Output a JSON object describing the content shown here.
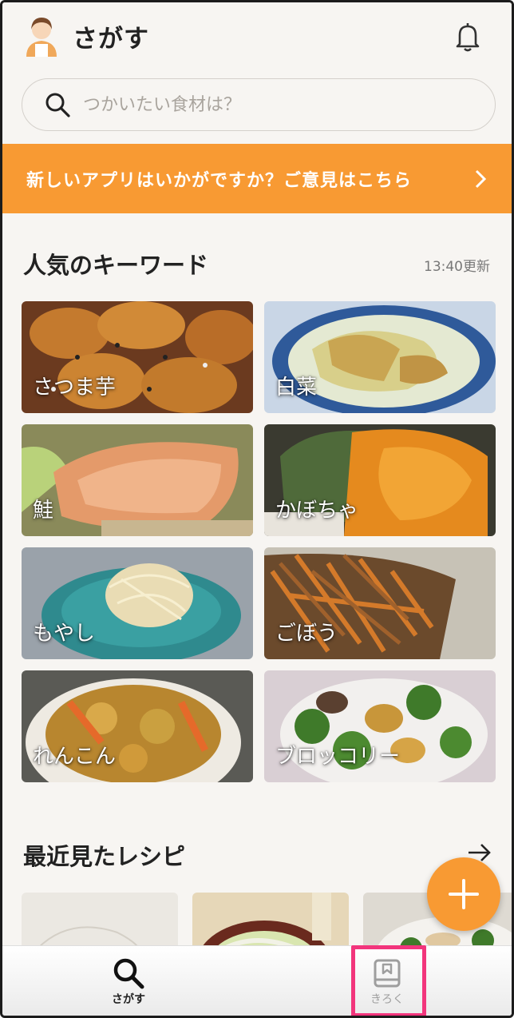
{
  "header": {
    "title": "さがす"
  },
  "search": {
    "placeholder": "つかいたい食材は？"
  },
  "banner": {
    "text": "新しいアプリはいかがですか？ご意見はこちら"
  },
  "keywords": {
    "title": "人気のキーワード",
    "updated": "13:40更新",
    "items": [
      {
        "label": "さつま芋"
      },
      {
        "label": "白菜"
      },
      {
        "label": "鮭"
      },
      {
        "label": "かぼちゃ"
      },
      {
        "label": "もやし"
      },
      {
        "label": "ごぼう"
      },
      {
        "label": "れんこん"
      },
      {
        "label": "ブロッコリー"
      }
    ]
  },
  "recent": {
    "title": "最近見たレシピ"
  },
  "tabbar": {
    "search_label": "さがす",
    "record_label": "きろく"
  },
  "colors": {
    "accent": "#f89a33",
    "highlight": "#f2357c",
    "background": "#f7f5f2"
  }
}
